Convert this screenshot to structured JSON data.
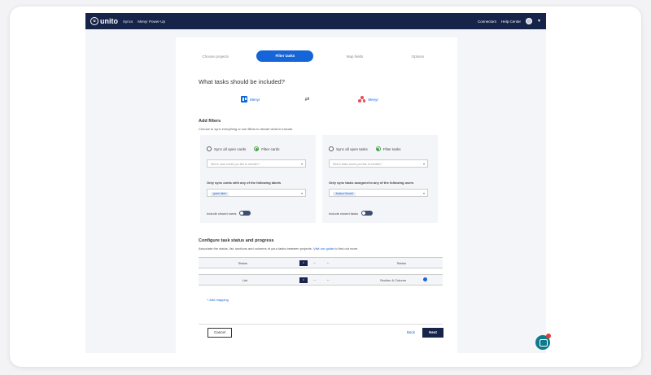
{
  "topbar": {
    "brand": "unito",
    "crumb_1": "Syncs",
    "crumb_2": "Menyr Power-Up",
    "connectors": "Connectors",
    "help": "Help Center"
  },
  "steps": [
    "Choose projects",
    "Filter tasks",
    "Map fields",
    "Options"
  ],
  "question": "What tasks should be included?",
  "tools": {
    "left": "Menyr",
    "right": "Menyr"
  },
  "filters": {
    "heading": "Add filters",
    "subtitle": "Choose to sync everything or use filters to decide what to include.",
    "left": {
      "radio_1": "Sync all open cards",
      "radio_2": "Filter cards",
      "select_placeholder": "Which rows would you like to transfer?",
      "label": "Only sync cards with any of the following labels",
      "chip": "green label",
      "closed": "Include closed cards"
    },
    "right": {
      "radio_1": "Sync all open tasks",
      "radio_2": "Filter tasks",
      "select_placeholder": "Which tasks would you like to transfer?",
      "label": "Only sync tasks assigned to any of the following users",
      "chip": "Jessica Vincent",
      "closed": "Include closed tasks"
    }
  },
  "status": {
    "heading": "Configure task status and progress",
    "subtitle": "Associate the status, list, sections and columns of your tasks between projects.",
    "guide_link": "Visit our guide",
    "subtitle_end": "to find out more.",
    "rows": [
      {
        "left": "Status",
        "right": "Status"
      },
      {
        "left": "List",
        "right": "Section & Column"
      }
    ],
    "add_mapping": "+ Add mapping"
  },
  "footer": {
    "cancel": "Cancel",
    "back": "Back",
    "next": "Next"
  }
}
